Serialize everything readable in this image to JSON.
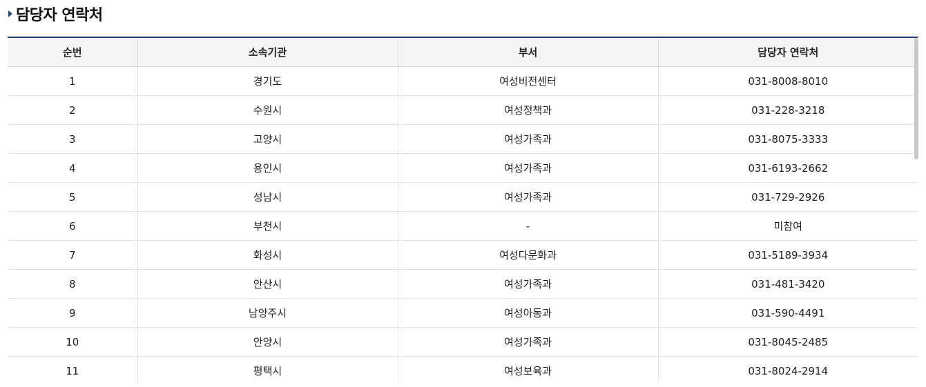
{
  "title": "담당자 연락처",
  "table": {
    "headers": [
      "순번",
      "소속기관",
      "부서",
      "담당자 연락처"
    ],
    "rows": [
      [
        "1",
        "경기도",
        "여성비전센터",
        "031-8008-8010"
      ],
      [
        "2",
        "수원시",
        "여성정책과",
        "031-228-3218"
      ],
      [
        "3",
        "고양시",
        "여성가족과",
        "031-8075-3333"
      ],
      [
        "4",
        "용인시",
        "여성가족과",
        "031-6193-2662"
      ],
      [
        "5",
        "성남시",
        "여성가족과",
        "031-729-2926"
      ],
      [
        "6",
        "부천시",
        "-",
        "미참여"
      ],
      [
        "7",
        "화성시",
        "여성다문화과",
        "031-5189-3934"
      ],
      [
        "8",
        "안산시",
        "여성가족과",
        "031-481-3420"
      ],
      [
        "9",
        "남양주시",
        "여성아동과",
        "031-590-4491"
      ],
      [
        "10",
        "안양시",
        "여성가족과",
        "031-8045-2485"
      ],
      [
        "11",
        "평택시",
        "여성보육과",
        "031-8024-2914"
      ]
    ]
  },
  "colors": {
    "accent": "#1f4e8c",
    "header_bg": "#f3f4f6",
    "top_border": "#203f6b"
  },
  "icons": {
    "title_marker": "triangle-right-icon"
  }
}
